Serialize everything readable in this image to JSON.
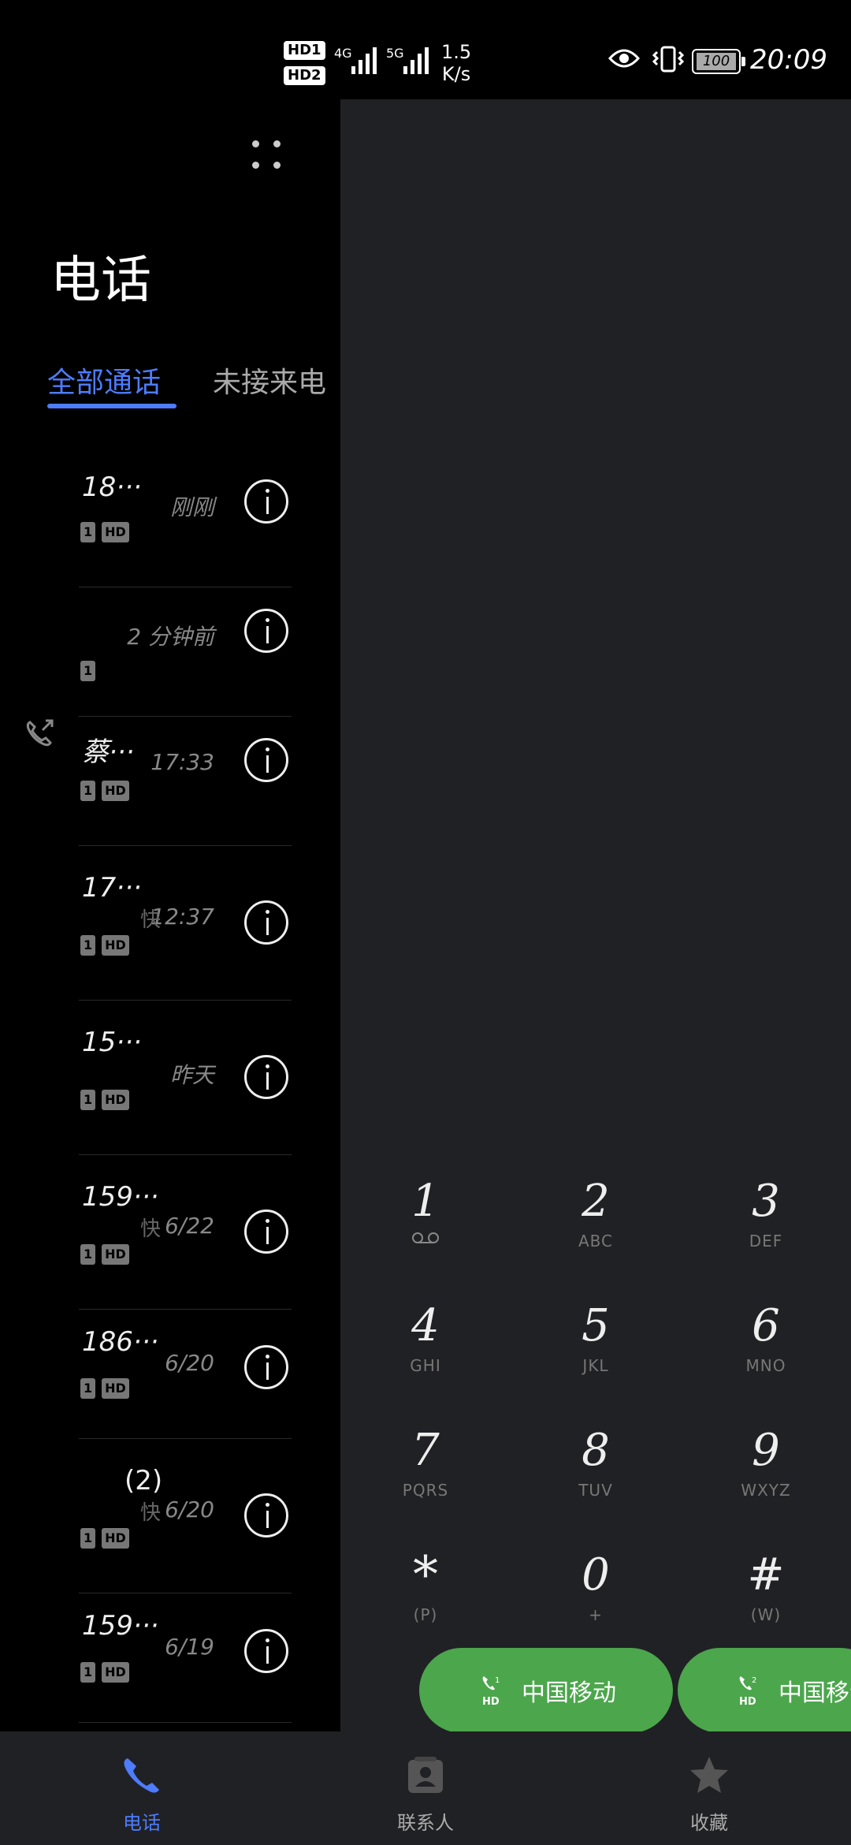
{
  "status_bar": {
    "sim1_label": "HD",
    "sim1_num": "1",
    "sim2_label": "HD",
    "sim2_num": "2",
    "net1": "4G",
    "net2": "5G",
    "speed_value": "1.5",
    "speed_unit": "K/s",
    "battery": "100",
    "time": "20:09"
  },
  "header": {
    "title": "电话",
    "tabs": [
      {
        "label": "全部通话",
        "active": true
      },
      {
        "label": "未接来电",
        "active": false
      }
    ]
  },
  "calls": [
    {
      "name": "18···",
      "time": "刚刚",
      "sim": "1",
      "hd": "HD",
      "frag": ""
    },
    {
      "name": "",
      "time": "2 分钟前",
      "sim": "1",
      "hd": "",
      "frag": ""
    },
    {
      "name": "蔡···",
      "time": "17:33",
      "sim": "1",
      "hd": "HD",
      "frag": ""
    },
    {
      "name": "17···",
      "time": "12:37",
      "sim": "1",
      "hd": "HD",
      "frag": "快"
    },
    {
      "name": "15···",
      "time": "昨天",
      "sim": "1",
      "hd": "HD",
      "frag": ""
    },
    {
      "name": "159···",
      "time": "6/22",
      "sim": "1",
      "hd": "HD",
      "frag": "快"
    },
    {
      "name": "186···",
      "time": "6/20",
      "sim": "1",
      "hd": "HD",
      "frag": ""
    },
    {
      "name": "(2)",
      "time": "6/20",
      "sim": "1",
      "hd": "HD",
      "frag": "快"
    },
    {
      "name": "159···",
      "time": "6/19",
      "sim": "1",
      "hd": "HD",
      "frag": ""
    }
  ],
  "dialpad": {
    "keys": [
      {
        "digit": "1",
        "letters": ""
      },
      {
        "digit": "2",
        "letters": "ABC"
      },
      {
        "digit": "3",
        "letters": "DEF"
      },
      {
        "digit": "4",
        "letters": "GHI"
      },
      {
        "digit": "5",
        "letters": "JKL"
      },
      {
        "digit": "6",
        "letters": "MNO"
      },
      {
        "digit": "7",
        "letters": "PQRS"
      },
      {
        "digit": "8",
        "letters": "TUV"
      },
      {
        "digit": "9",
        "letters": "WXYZ"
      },
      {
        "digit": "*",
        "letters": "(P)"
      },
      {
        "digit": "0",
        "letters": "+"
      },
      {
        "digit": "#",
        "letters": "(W)"
      }
    ],
    "sim_buttons": [
      {
        "sim": "1",
        "label": "中国移动"
      },
      {
        "sim": "2",
        "label": "中国移动"
      }
    ]
  },
  "bottom_nav": [
    {
      "label": "电话",
      "active": true
    },
    {
      "label": "联系人",
      "active": false
    },
    {
      "label": "收藏",
      "active": false
    }
  ],
  "colors": {
    "accent": "#4d7cff",
    "call_button": "#4ca64c",
    "panel_bg": "#202124"
  }
}
